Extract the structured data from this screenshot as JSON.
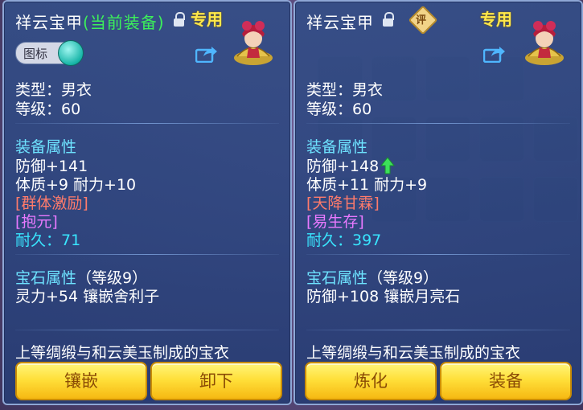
{
  "left_panel": {
    "title": "祥云宝甲",
    "title_suffix": "(当前装备)",
    "exclusive": "专用",
    "toggle_label": "图标",
    "type": "类型：男衣",
    "level": "等级：60",
    "attr_header": "装备属性",
    "defense": "防御+141",
    "stats": "体质+9 耐力+10",
    "skill1": "[群体激励]",
    "skill2": "[抱元]",
    "durability": "耐久：71",
    "gem_header": "宝石属性",
    "gem_level": "（等级9）",
    "gem_stat": "灵力+54 镶嵌舍利子",
    "description": "上等绸缎与和云美玉制成的宝衣",
    "buttons": [
      "镶嵌",
      "卸下"
    ]
  },
  "right_panel": {
    "title": "祥云宝甲",
    "rate_badge": "评",
    "exclusive": "专用",
    "type": "类型：男衣",
    "level": "等级：60",
    "attr_header": "装备属性",
    "defense": "防御+148",
    "stats": "体质+11 耐力+9",
    "skill1": "[天降甘霖]",
    "skill2": "[易生存]",
    "durability": "耐久：397",
    "gem_header": "宝石属性",
    "gem_level": "（等级9）",
    "gem_stat": "防御+108 镶嵌月亮石",
    "description": "上等绸缎与和云美玉制成的宝衣",
    "buttons": [
      "炼化",
      "装备"
    ]
  },
  "colors": {
    "green": "#3cf05a",
    "yellow": "#ffe84a",
    "header_blue": "#6ee3ff",
    "red": "#ff7b6b",
    "pink": "#e879ff",
    "cyan": "#39e6ff"
  }
}
